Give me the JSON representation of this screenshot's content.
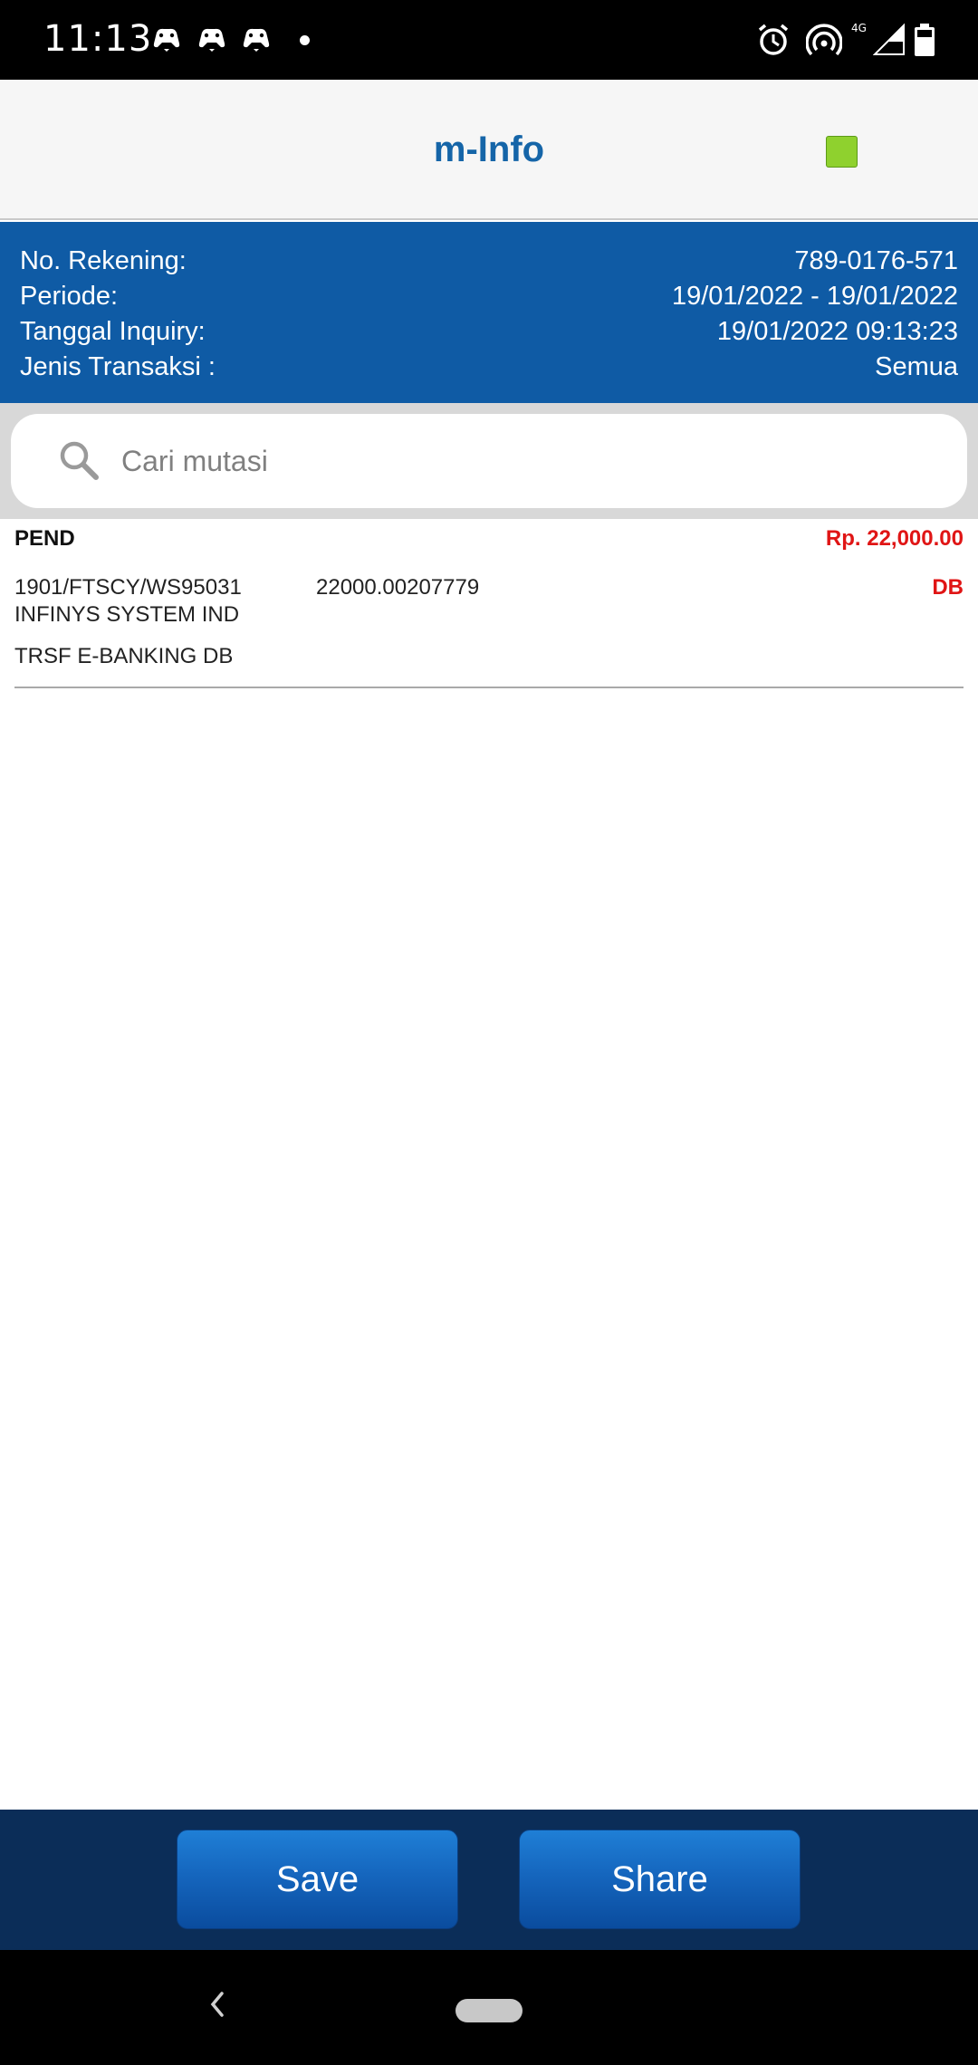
{
  "status_bar": {
    "time": "11:13",
    "network_label": "4G"
  },
  "header": {
    "title": "m-Info"
  },
  "account_info": {
    "rows": [
      {
        "label": "No. Rekening:",
        "value": "789-0176-571"
      },
      {
        "label": "Periode:",
        "value": "19/01/2022 - 19/01/2022"
      },
      {
        "label": "Tanggal Inquiry:",
        "value": "19/01/2022 09:13:23"
      },
      {
        "label": "Jenis Transaksi :",
        "value": "Semua"
      }
    ]
  },
  "search": {
    "placeholder": "Cari mutasi",
    "value": ""
  },
  "transactions": [
    {
      "status": "PEND",
      "amount": "Rp. 22,000.00",
      "reference": "1901/FTSCY/WS95031",
      "code": "22000.00207779",
      "type": "DB",
      "name": "INFINYS SYSTEM IND",
      "description": "TRSF E-BANKING DB"
    }
  ],
  "actions": {
    "save_label": "Save",
    "share_label": "Share"
  },
  "colors": {
    "primary": "#0f5ba5",
    "title": "#1565a8",
    "debit": "#e01515",
    "indicator": "#8fd12e",
    "bottom_bar": "#0b2d58"
  }
}
